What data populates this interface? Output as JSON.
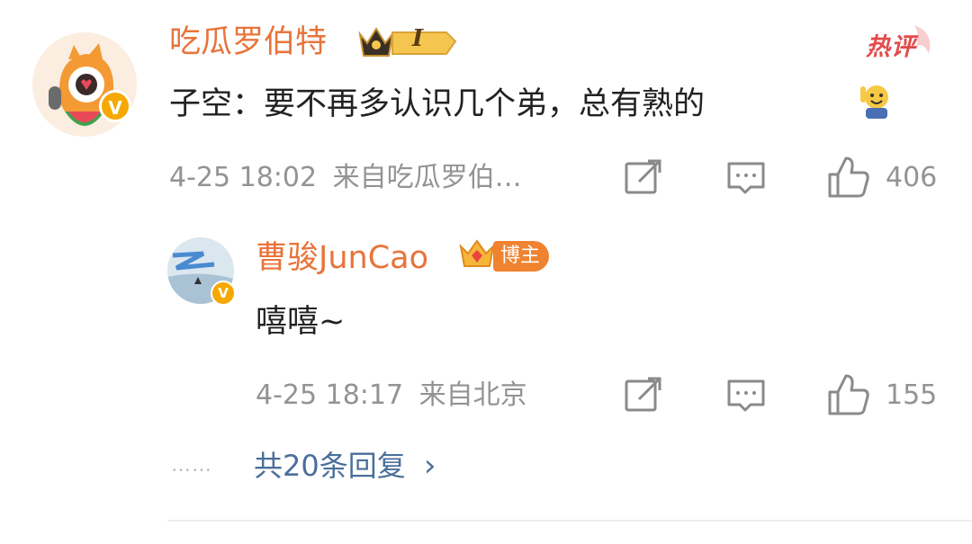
{
  "comment": {
    "user_name": "吃瓜罗伯特",
    "level_badge": "I",
    "verified_mark": "V",
    "hot_label": "热评",
    "text": "子空：要不再多认识几个弟，总有熟的",
    "emoji_icon": "raising-hand-emoji-icon",
    "time": "4-25 18:02",
    "source": "来自吃瓜罗伯…",
    "like_count": "406"
  },
  "reply": {
    "user_name": "曹骏JunCao",
    "blogger_tag": "博主",
    "verified_mark": "V",
    "text": "嘻嘻~",
    "time": "4-25 18:17",
    "source": "来自北京",
    "like_count": "155"
  },
  "more_replies": {
    "dots": "……",
    "label": "共20条回复",
    "chevron": "›"
  },
  "colors": {
    "username": "#e8743b",
    "link": "#4a6f9a",
    "meta": "#939393",
    "hot": "#e34b4b",
    "verify": "#f6a800"
  }
}
